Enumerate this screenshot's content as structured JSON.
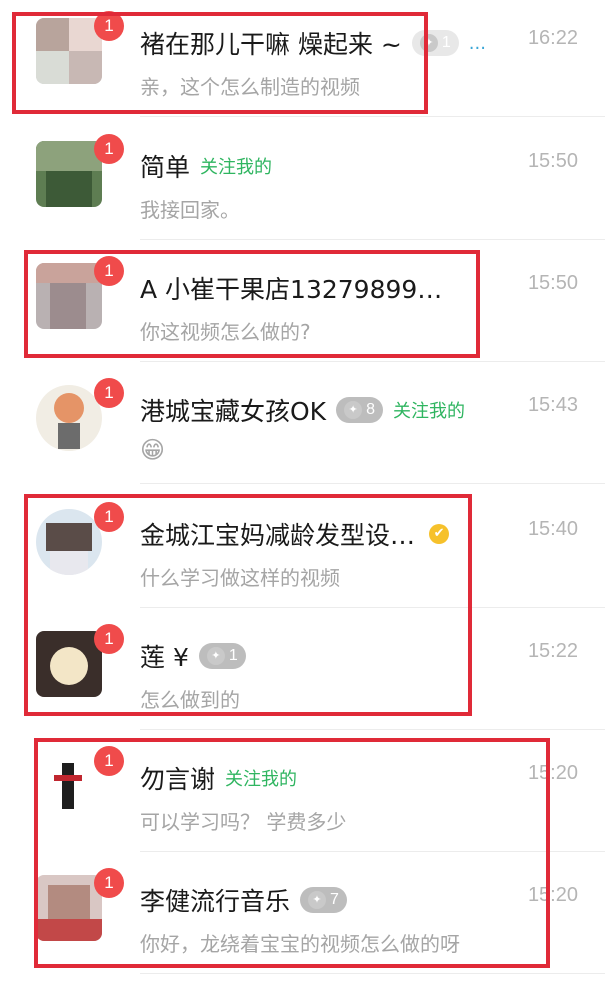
{
  "conversations": [
    {
      "name": "褚在那儿干嘛 燥起来 ~",
      "tag": "1",
      "extra": "...",
      "time": "16:22",
      "message": "亲，这个怎么制造的视频",
      "badge": "1"
    },
    {
      "name": "简单",
      "follow": "关注我的",
      "time": "15:50",
      "message": "我接回家。",
      "badge": "1"
    },
    {
      "name": "A 小崔干果店13279899…",
      "time": "15:50",
      "message": "你这视频怎么做的?",
      "badge": "1"
    },
    {
      "name": "港城宝藏女孩OK",
      "tag": "8",
      "follow": "关注我的",
      "time": "15:43",
      "message": "😁",
      "badge": "1"
    },
    {
      "name": "金城江宝妈减龄发型设…",
      "verified": "✔",
      "time": "15:40",
      "message": "什么学习做这样的视频",
      "badge": "1"
    },
    {
      "name": "莲 ¥",
      "tag": "1",
      "time": "15:22",
      "message": "怎么做到的",
      "badge": "1"
    },
    {
      "name": "勿言谢",
      "follow": "关注我的",
      "time": "15:20",
      "message": "可以学习吗？ 学费多少",
      "badge": "1"
    },
    {
      "name": "李健流行音乐",
      "tag": "7",
      "time": "15:20",
      "message": "你好，龙绕着宝宝的视频怎么做的呀",
      "badge": "1"
    }
  ],
  "colors": {
    "badge": "#f04b4b",
    "follow": "#2fb560",
    "highlight": "#e02a38",
    "time": "#b5b5b5"
  }
}
